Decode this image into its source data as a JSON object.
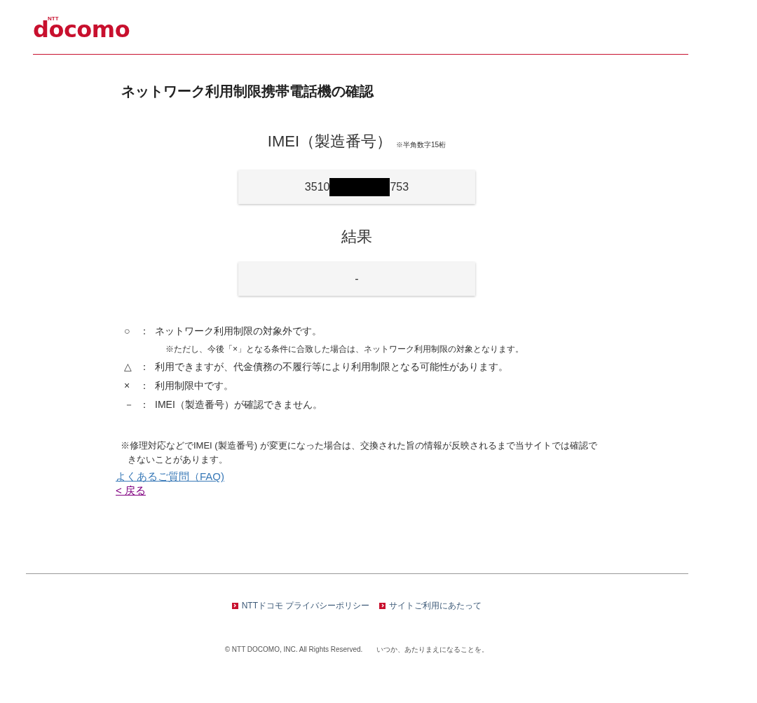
{
  "logo": {
    "small": "NTT",
    "main": "docomo"
  },
  "title": "ネットワーク利用制限携帯電話機の確認",
  "imei": {
    "label": "IMEI（製造番号）",
    "hint": "※半角数字15桁",
    "value_start": "3510",
    "value_end": "753"
  },
  "result": {
    "label": "結果",
    "value": "-"
  },
  "legend": [
    {
      "symbol": "○",
      "separator": "：",
      "text": "ネットワーク利用制限の対象外です。",
      "note": "※ただし、今後「×」となる条件に合致した場合は、ネットワーク利用制限の対象となります。"
    },
    {
      "symbol": "△",
      "separator": "：",
      "text": "利用できますが、代金債務の不履行等により利用制限となる可能性があります。"
    },
    {
      "symbol": "×",
      "separator": "：",
      "text": "利用制限中です。"
    },
    {
      "symbol": "－",
      "separator": "：",
      "text": "IMEI（製造番号）が確認できません。"
    }
  ],
  "note": "※修理対応などでIMEI (製造番号) が変更になった場合は、交換された旨の情報が反映されるまで当サイトでは確認できないことがあります。",
  "links": [
    {
      "label": "よくあるご質問（FAQ)",
      "visited": false
    },
    {
      "label": "< 戻る",
      "visited": true
    }
  ],
  "footer": {
    "links": [
      "NTTドコモ プライバシーポリシー",
      "サイトご利用にあたって"
    ],
    "copyright": "© NTT DOCOMO, INC. All Rights Reserved.",
    "slogan": "いつか、あたりまえになることを。"
  }
}
